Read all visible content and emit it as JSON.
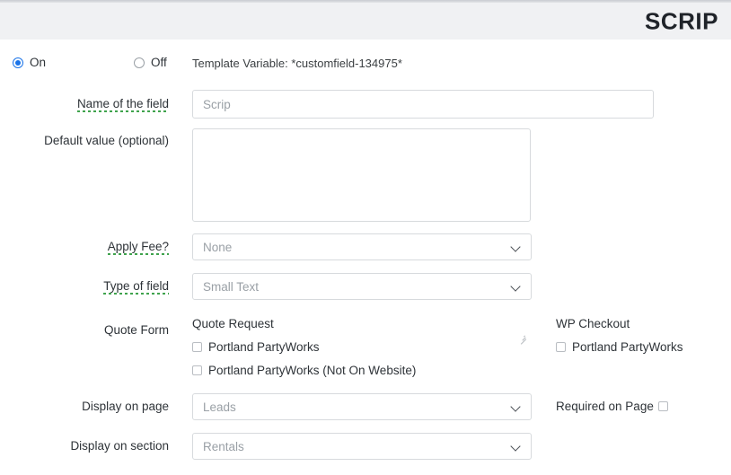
{
  "header": {
    "title": "SCRIP"
  },
  "status_toggle": {
    "on_label": "On",
    "off_label": "Off",
    "selected": "On"
  },
  "template_variable": {
    "text": "Template Variable: *customfield-134975*"
  },
  "fields": {
    "name_of_field": {
      "label": "Name of the field",
      "value": "Scrip",
      "placeholder": "Scrip"
    },
    "default_value": {
      "label": "Default value (optional)",
      "value": "",
      "placeholder": ""
    },
    "apply_fee": {
      "label": "Apply Fee?",
      "value": "None"
    },
    "type_of_field": {
      "label": "Type of field",
      "value": "Small Text"
    },
    "display_on_page": {
      "label": "Display on page",
      "value": "Leads"
    },
    "display_on_section": {
      "label": "Display on section",
      "value": "Rentals"
    }
  },
  "quote_form": {
    "label": "Quote Form",
    "columns": [
      {
        "heading": "Quote Request",
        "options": [
          {
            "label": "Portland PartyWorks",
            "checked": false
          },
          {
            "label": "Portland PartyWorks (Not On Website)",
            "checked": false
          }
        ]
      },
      {
        "heading": "WP Checkout",
        "options": [
          {
            "label": "Portland PartyWorks",
            "checked": false
          }
        ]
      }
    ]
  },
  "required_on_page": {
    "label": "Required on Page",
    "checked": false
  },
  "colors": {
    "header_bg": "#f0f1f3",
    "accent_radio": "#1a73e8",
    "spellcheck_underline": "#3fa34d",
    "border": "#d7dadd",
    "text": "#2e3338",
    "placeholder": "#9aa0a6"
  }
}
